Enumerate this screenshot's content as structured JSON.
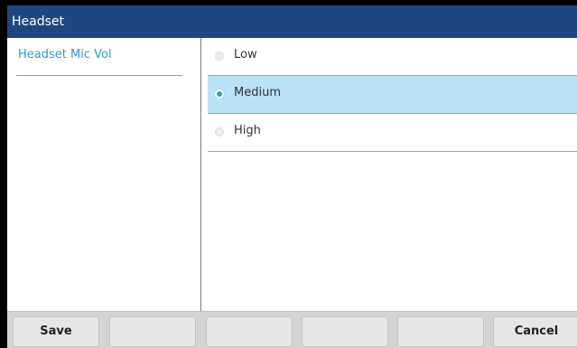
{
  "window": {
    "title": "Headset"
  },
  "sidebar": {
    "items": [
      {
        "label": "Headset Mic Vol"
      }
    ]
  },
  "options": {
    "selected": "Medium",
    "items": [
      {
        "label": "Low",
        "selected": false
      },
      {
        "label": "Medium",
        "selected": true
      },
      {
        "label": "High",
        "selected": false
      }
    ]
  },
  "softkeys": [
    {
      "label": "Save"
    },
    {
      "label": ""
    },
    {
      "label": ""
    },
    {
      "label": ""
    },
    {
      "label": ""
    },
    {
      "label": "Cancel"
    }
  ],
  "colors": {
    "titlebar": "#1e4782",
    "accent": "#2f9ad2",
    "selected_row": "#b9e2f6"
  }
}
